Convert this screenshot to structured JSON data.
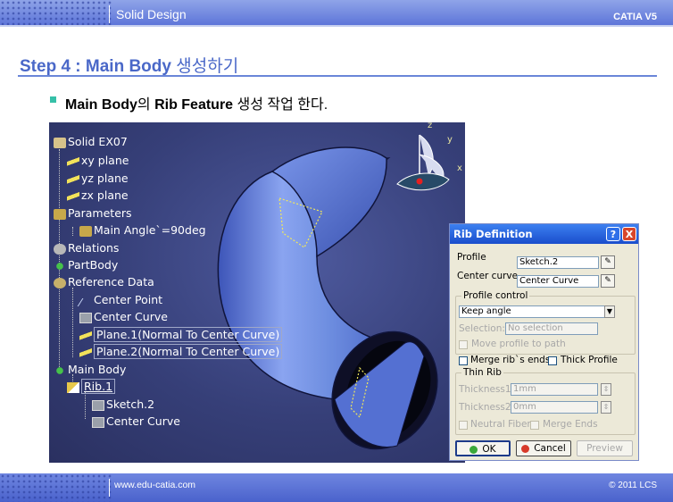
{
  "header": {
    "title": "Solid Design",
    "brand": "CATIA V5"
  },
  "step": {
    "prefix": "Step 4 : Main Body ",
    "suffix": "생성하기"
  },
  "subtitle": {
    "p1": "Main Body",
    "p2": "의 ",
    "p3": "Rib Feature",
    "p4": " 생성 작업 한다."
  },
  "tree": {
    "root": "Solid EX07",
    "xy": "xy plane",
    "yz": "yz plane",
    "zx": "zx plane",
    "parameters": "Parameters",
    "main_angle": "Main Angle`=90deg",
    "relations": "Relations",
    "partbody": "PartBody",
    "reference_data": "Reference Data",
    "center_point": "Center Point",
    "center_curve": "Center Curve",
    "plane1": "Plane.1(Normal To Center Curve)",
    "plane2": "Plane.2(Normal To Center Curve)",
    "main_body": "Main Body",
    "rib1": "Rib.1",
    "sketch2": "Sketch.2",
    "center_curve2": "Center Curve"
  },
  "compass": {
    "z": "z",
    "y": "y",
    "x": "x"
  },
  "dialog": {
    "title": "Rib Definition",
    "help": "?",
    "close": "X",
    "profile_label": "Profile",
    "profile_value": "Sketch.2",
    "center_curve_label": "Center curve",
    "center_curve_value": "Center Curve",
    "profile_control_group": "Profile control",
    "profile_control_value": "Keep angle",
    "selection_label": "Selection:",
    "selection_value": "No selection",
    "move_profile": "Move profile to path",
    "merge_ribs": "Merge rib`s ends",
    "thick_profile": "Thick Profile",
    "thin_rib_group": "Thin Rib",
    "thickness1_label": "Thickness1:",
    "thickness1_value": "1mm",
    "thickness2_label": "Thickness2:",
    "thickness2_value": "0mm",
    "neutral_fiber": "Neutral Fiber",
    "merge_ends": "Merge Ends",
    "ok": "OK",
    "cancel": "Cancel",
    "preview": "Preview"
  },
  "footer": {
    "url": "www.edu-catia.com",
    "copyright": "© 2011 LCS"
  },
  "colors": {
    "accent": "#4a68c8",
    "viewport_bg": "#363f78",
    "pipe": "#6e8ee0",
    "dialog_bg": "#ece9d8",
    "dialog_title": "#1a4dcc"
  },
  "icons": [
    "plane-icon",
    "body-icon",
    "sketch-icon",
    "parameters-icon",
    "relations-icon",
    "reference-icon",
    "point-icon",
    "rib-icon",
    "compass-icon",
    "edit-sketch-icon"
  ]
}
